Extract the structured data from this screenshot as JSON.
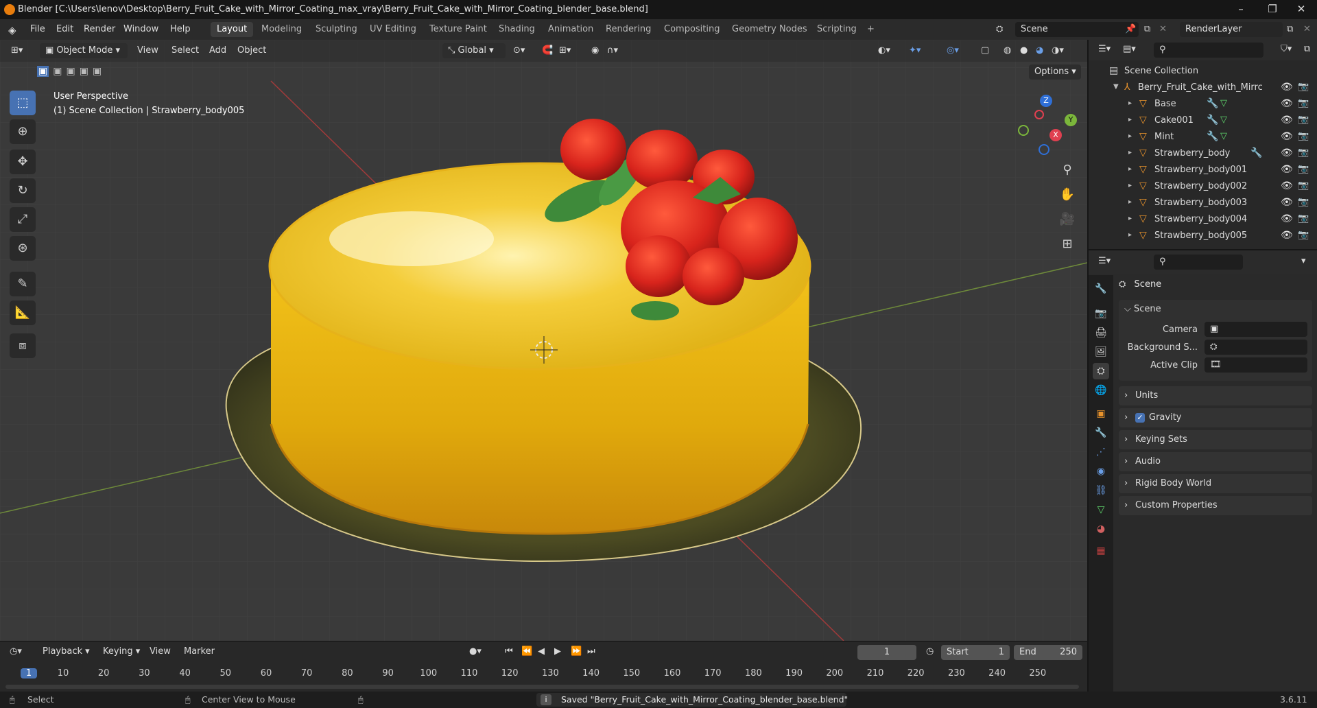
{
  "window": {
    "title": "Blender [C:\\Users\\lenov\\Desktop\\Berry_Fruit_Cake_with_Mirror_Coating_max_vray\\Berry_Fruit_Cake_with_Mirror_Coating_blender_base.blend]",
    "minimize": "–",
    "restore": "❐",
    "close": "✕"
  },
  "menubar": [
    "File",
    "Edit",
    "Render",
    "Window",
    "Help"
  ],
  "workspaces": [
    "Layout",
    "Modeling",
    "Sculpting",
    "UV Editing",
    "Texture Paint",
    "Shading",
    "Animation",
    "Rendering",
    "Compositing",
    "Geometry Nodes",
    "Scripting",
    "+"
  ],
  "active_workspace": "Layout",
  "scene_field": "Scene",
  "renderlayer_field": "RenderLayer",
  "viewport": {
    "mode": "Object Mode",
    "menus": [
      "View",
      "Select",
      "Add",
      "Object"
    ],
    "orientation": "Global",
    "options_label": "Options",
    "info_line1": "User Perspective",
    "info_line2": "(1) Scene Collection | Strawberry_body005",
    "gizmo": {
      "z": "Z",
      "y": "Y",
      "x": "X"
    }
  },
  "outliner": {
    "root": "Scene Collection",
    "collection": "Berry_Fruit_Cake_with_Mirrc",
    "items": [
      {
        "name": "Base",
        "modifier": true,
        "mesh": true
      },
      {
        "name": "Cake001",
        "modifier": true,
        "mesh": true
      },
      {
        "name": "Mint",
        "modifier": true,
        "mesh": true
      },
      {
        "name": "Strawberry_body",
        "modifier": true,
        "mesh": false
      },
      {
        "name": "Strawberry_body001",
        "modifier": false,
        "mesh": false
      },
      {
        "name": "Strawberry_body002",
        "modifier": false,
        "mesh": false
      },
      {
        "name": "Strawberry_body003",
        "modifier": false,
        "mesh": false
      },
      {
        "name": "Strawberry_body004",
        "modifier": false,
        "mesh": false
      },
      {
        "name": "Strawberry_body005",
        "modifier": false,
        "mesh": false
      }
    ]
  },
  "properties": {
    "header": "Scene",
    "section": "Scene",
    "camera_label": "Camera",
    "background_label": "Background S...",
    "active_clip_label": "Active Clip",
    "panels": [
      "Units",
      "Gravity",
      "Keying Sets",
      "Audio",
      "Rigid Body World",
      "Custom Properties"
    ],
    "gravity_checked": true
  },
  "timeline": {
    "menus": [
      "Playback",
      "Keying",
      "View",
      "Marker"
    ],
    "current_frame": "1",
    "start_label": "Start",
    "start": "1",
    "end_label": "End",
    "end": "250",
    "ruler": [
      "1",
      "10",
      "20",
      "30",
      "40",
      "50",
      "60",
      "70",
      "80",
      "90",
      "100",
      "110",
      "120",
      "130",
      "140",
      "150",
      "160",
      "170",
      "180",
      "190",
      "200",
      "210",
      "220",
      "230",
      "240",
      "250"
    ]
  },
  "statusbar": {
    "select": "Select",
    "center_view": "Center View to Mouse",
    "message": "Saved \"Berry_Fruit_Cake_with_Mirror_Coating_blender_base.blend\"",
    "version": "3.6.11"
  },
  "colors": {
    "accent": "#4772b3",
    "cake": "#e9b80f",
    "strawberry": "#d8241c",
    "mint": "#3e8a3a"
  }
}
